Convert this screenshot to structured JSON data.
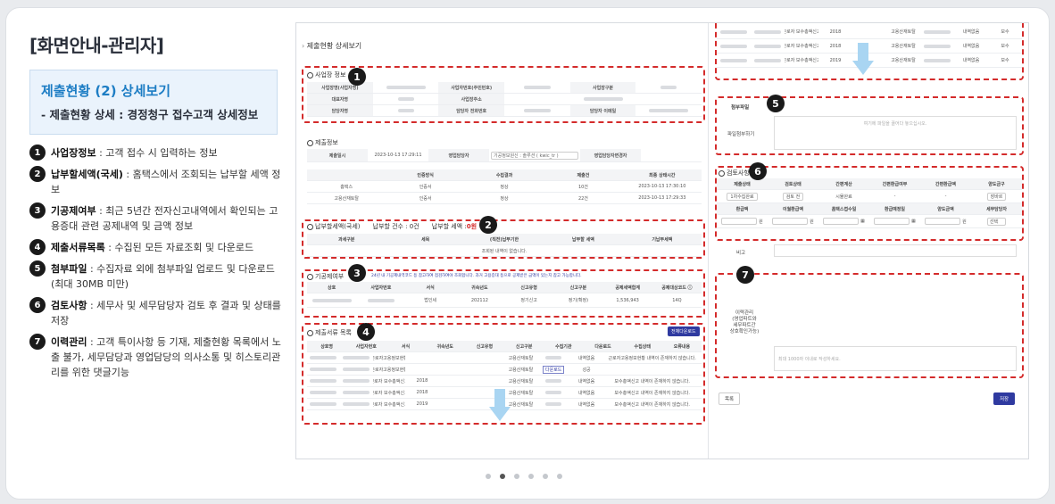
{
  "left": {
    "header": "[화면안내-관리자]",
    "box_title": "제출현황 (2) 상세보기",
    "box_subtitle": "- 제출현황 상세 : 경정청구 접수고객 상세정보",
    "items": [
      {
        "num": "1",
        "name": "사업장정보",
        "desc": " : 고객 접수 시 입력하는 정보"
      },
      {
        "num": "2",
        "name": "납부할세액(국세)",
        "desc": " : 홈택스에서 조회되는 납부할 세액 정보"
      },
      {
        "num": "3",
        "name": "기공제여부",
        "desc": " : 최근 5년간 전자신고내역에서 확인되는 고용증대 관련 공제내역 및 금액 정보"
      },
      {
        "num": "4",
        "name": "제출서류목록",
        "desc": " : 수집된 모든 자료조회 및 다운로드"
      },
      {
        "num": "5",
        "name": "첨부파일",
        "desc": " : 수집자료 외에 첨부파일 업로드 및 다운로드 (최대 30MB 미만)"
      },
      {
        "num": "6",
        "name": "검토사항",
        "desc": " : 세무사 및 세무담당자 검토 후 결과 및 상태를 저장"
      },
      {
        "num": "7",
        "name": "이력관리",
        "desc": " : 고객 특이사항 등 기재, 제출현황 목록에서 노출 불가, 세무담당과 영업담당의 의사소통 및 히스토리관리를 위한 댓글기능"
      }
    ]
  },
  "screen": {
    "page_title": "제출현황 상세보기",
    "badges": [
      "1",
      "2",
      "3",
      "4",
      "5",
      "6",
      "7"
    ],
    "s1": {
      "title": "사업장 정보",
      "labels": [
        "사업장명(사업자명)",
        "사업자번호(주민번호)",
        "사업장구분",
        "대표자명",
        "사업장주소",
        "담당자명",
        "담당자 전화번호",
        "담당자 이메일"
      ]
    },
    "s_submit": {
      "title": "제출정보",
      "date_label": "제출일시",
      "date_value": "2023-10-13 17:29:11",
      "sales_label": "영업담당자",
      "sales_value": "기공정보원신 : 솔루션 ( kwic_tr )",
      "sales2_label": "영업담당자변경자",
      "headers": [
        "",
        "인증방식",
        "수집결과",
        "제출건",
        "최종 상태시간"
      ],
      "rows": [
        [
          "홈택스",
          "인증서",
          "정상",
          "10건",
          "2023-10-13 17:30:10"
        ],
        [
          "고용산재토탈",
          "인증서",
          "정상",
          "22건",
          "2023-10-13 17:29:33"
        ]
      ]
    },
    "s2": {
      "title": "납부할세액(국세)",
      "count_label": "납부할 건수 : 0건",
      "amount_label": "납부할 세액 : ",
      "amount_value": "0원",
      "headers": [
        "과세구분",
        "세목",
        "(직전)납부기한",
        "납부할 세액",
        "기납부세액"
      ],
      "empty": "조회된 내역이 없습니다."
    },
    "s3": {
      "title": "기공제여부",
      "note": "24년 내 기공제내역코드 등 참고하여 점검하여야 조회합니다. 과거 고용증대 등으로 공제받은 금액이 있는지 참고 가능합니다.",
      "headers": [
        "상호",
        "사업자번호",
        "서식",
        "귀속년도",
        "신고유형",
        "신고구분",
        "공제세액합계",
        "공제대상코드 ⓘ"
      ],
      "row": [
        "",
        "",
        "법인세",
        "202112",
        "정기신고",
        "정기(확정)",
        "1,536,943",
        "14Q"
      ]
    },
    "s4": {
      "title": "제출서류 목록",
      "download_all": "전체다운로드",
      "headers": [
        "상호명",
        "사업자번호",
        "서식",
        "귀속년도",
        "신고유형",
        "신고구분",
        "수집기관",
        "다운로드",
        "수집상태",
        "오류내용"
      ],
      "rows": [
        {
          "form": "근로자고용정보현황",
          "year": "",
          "org": "고용산재토탈",
          "dl": "",
          "status": "내역없음",
          "err": "근로자고용정보현황 내역이 존재하지 않습니다."
        },
        {
          "form": "근로자고용정보현황",
          "year": "",
          "org": "고용산재토탈",
          "dl": "다운로드",
          "status": "성공",
          "err": ""
        },
        {
          "form": "근로자 보수총액신고",
          "year": "2018",
          "org": "고용산재토탈",
          "dl": "",
          "status": "내역없음",
          "err": "보수총액신고 내역이 존재하지 않습니다."
        },
        {
          "form": "근로자 보수총액신고",
          "year": "2018",
          "org": "고용산재토탈",
          "dl": "",
          "status": "내역없음",
          "err": "보수총액신고 내역이 존재하지 않습니다."
        },
        {
          "form": "근로자 보수총액신고",
          "year": "2019",
          "org": "고용산재토탈",
          "dl": "",
          "status": "내역없음",
          "err": "보수총액신고 내역이 존재하지 않습니다."
        }
      ]
    },
    "top_right_rows": [
      {
        "form": "근로자 보수총액신고",
        "year": "2018",
        "org": "고용산재토탈",
        "status": "내역없음",
        "err": "보수"
      },
      {
        "form": "근로자 보수총액신고",
        "year": "2018",
        "org": "고용산재토탈",
        "status": "내역없음",
        "err": "보수"
      },
      {
        "form": "근로자 보수총액신고",
        "year": "2019",
        "org": "고용산재토탈",
        "status": "내역없음",
        "err": "보수"
      }
    ],
    "s5": {
      "title": "첨부파일",
      "label_attach": "파일첨부하기",
      "drop_hint": "여기에 파일을 끌어다 놓으십시오."
    },
    "s6": {
      "title": "검토사항",
      "headers1": [
        "제출상태",
        "검토상태",
        "간편계산",
        "간편환급여부",
        "간편환급액",
        "양도금구"
      ],
      "values1": [
        "1차수집완료",
        "검토 전",
        "시뮬완료",
        "-",
        "-",
        "장바르"
      ],
      "headers2": [
        "환급액",
        "이월환급액",
        "홈택스접수일",
        "환급예정일",
        "양도금액",
        "세무담당자"
      ],
      "unit": "원",
      "select_label": "선택"
    },
    "s_note": {
      "label": "비고"
    },
    "s7": {
      "label": "이력관리\n(영업파트와\n세무파트간\n상호확인가능)",
      "placeholder": "최대 1000자 이내로 작성하세요."
    },
    "footer": {
      "list_btn": "목록",
      "save_btn": "저장"
    }
  },
  "pagination": {
    "count": 6,
    "active_index": 1
  },
  "colors": {
    "accent": "#1d7dc4",
    "dashed": "#d42b2b",
    "badge": "#1a1a1a",
    "primary_btn": "#2f3aa0",
    "arrow": "#a9d5f2"
  }
}
